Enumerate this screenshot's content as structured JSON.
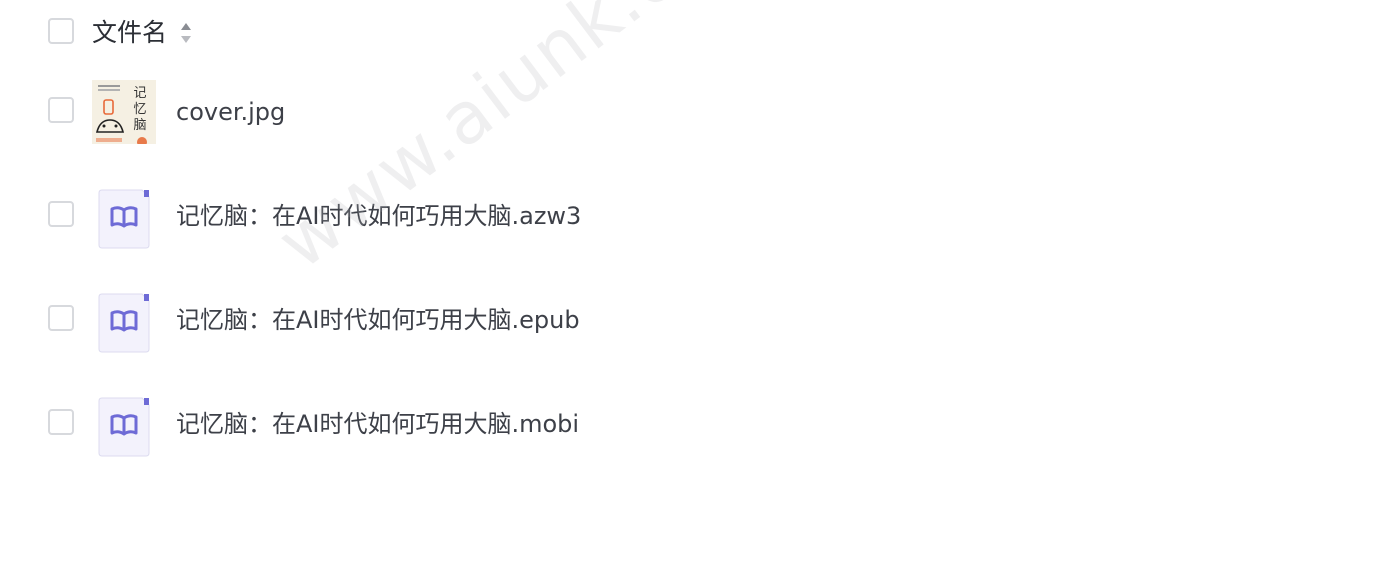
{
  "header": {
    "column_title": "文件名",
    "sort_icon": "sort-icon"
  },
  "files": [
    {
      "name": "cover.jpg",
      "icon": "image-thumbnail",
      "thumb_text": [
        "记",
        "忆",
        "脑"
      ]
    },
    {
      "name": "记忆脑：在AI时代如何巧用大脑.azw3",
      "icon": "book-file-icon"
    },
    {
      "name": "记忆脑：在AI时代如何巧用大脑.epub",
      "icon": "book-file-icon"
    },
    {
      "name": "记忆脑：在AI时代如何巧用大脑.mobi",
      "icon": "book-file-icon"
    }
  ],
  "watermark": "www.aiunk.com",
  "colors": {
    "icon_accent": "#6e6bd6",
    "icon_bg": "#f1f0fb",
    "checkbox_border": "#d7d9dd",
    "text": "#3d4048"
  }
}
